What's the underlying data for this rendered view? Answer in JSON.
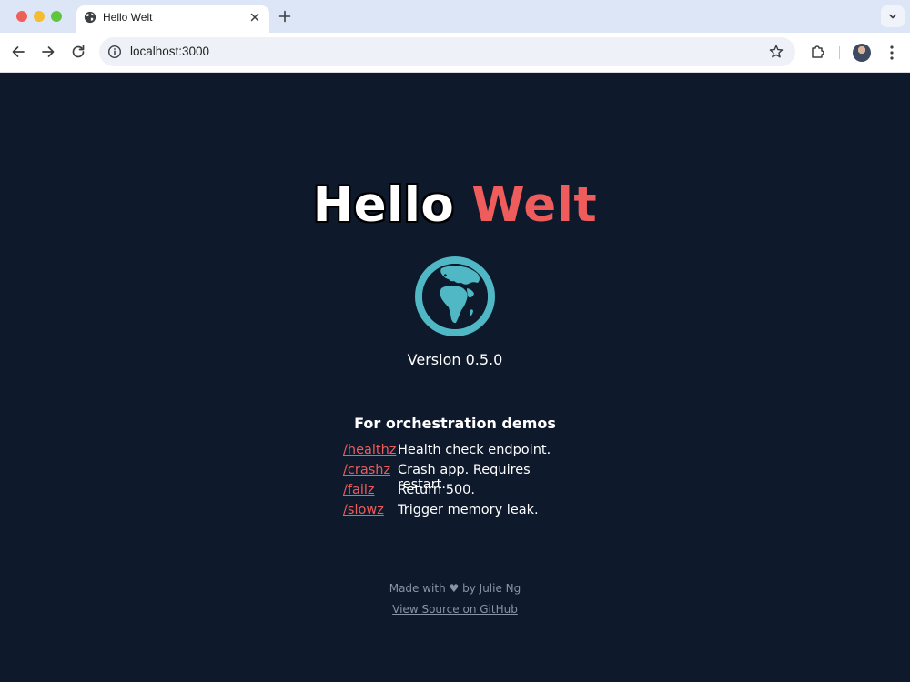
{
  "browser": {
    "tab_title": "Hello Welt",
    "url": "localhost:3000"
  },
  "page": {
    "heading_hello": "Hello",
    "heading_welt": "Welt",
    "version": "Version 0.5.0",
    "demos_title": "For orchestration demos",
    "links": [
      {
        "path": "/healthz",
        "description": "Health check endpoint."
      },
      {
        "path": "/crashz",
        "description": "Crash app. Requires restart."
      },
      {
        "path": "/failz",
        "description": "Return 500."
      },
      {
        "path": "/slowz",
        "description": "Trigger memory leak."
      }
    ],
    "footer_made_prefix": "Made with",
    "footer_made_suffix": "by Julie Ng",
    "footer_source": "View Source on GitHub"
  },
  "colors": {
    "page_background": "#0e192c",
    "accent": "#ee5c5c",
    "globe": "#4fb8c4",
    "footer_text": "#8a93a3"
  }
}
